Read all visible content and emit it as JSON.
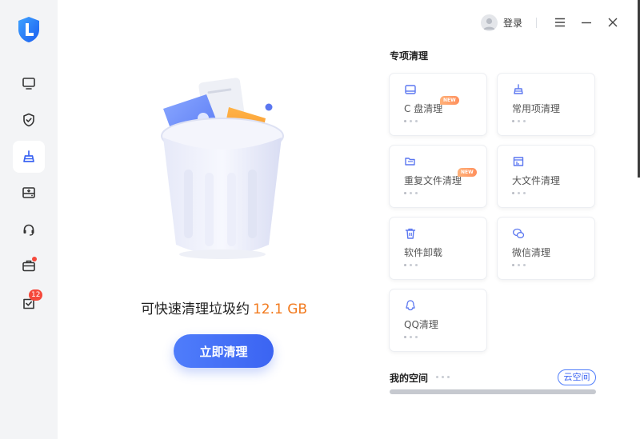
{
  "topbar": {
    "login_label": "登录",
    "avatar_icon": "user-avatar-icon",
    "menu_icon": "hamburger-menu-icon",
    "minimize_icon": "minimize-icon",
    "close_icon": "close-icon"
  },
  "sidebar": {
    "logo_icon": "shield-l-logo-icon",
    "items": [
      {
        "icon": "monitor-icon",
        "active": false
      },
      {
        "icon": "shield-check-icon",
        "active": false
      },
      {
        "icon": "broom-clean-icon",
        "active": true
      },
      {
        "icon": "hard-drive-icon",
        "active": false
      },
      {
        "icon": "headset-icon",
        "active": false
      },
      {
        "icon": "toolbox-icon",
        "active": false,
        "dot": true
      },
      {
        "icon": "mail-tasks-icon",
        "active": false,
        "badge": "12"
      }
    ]
  },
  "main": {
    "summary_prefix": "可快速清理垃圾约",
    "junk_amount": "12.1 GB",
    "clean_button": "立即清理"
  },
  "special_cleanup": {
    "title": "专项清理",
    "cards": [
      {
        "label": "C 盘清理",
        "icon": "drive-c-icon",
        "badge": "NEW"
      },
      {
        "label": "常用项清理",
        "icon": "broom-icon",
        "badge": ""
      },
      {
        "label": "重复文件清理",
        "icon": "duplicate-files-icon",
        "badge": "NEW"
      },
      {
        "label": "大文件清理",
        "icon": "large-file-icon",
        "badge": ""
      },
      {
        "label": "软件卸载",
        "icon": "trash-icon",
        "badge": ""
      },
      {
        "label": "微信清理",
        "icon": "wechat-icon",
        "badge": ""
      },
      {
        "label": "QQ清理",
        "icon": "qq-penguin-icon",
        "badge": ""
      }
    ]
  },
  "my_space": {
    "title": "我的空间",
    "cloud_button": "云空间",
    "usage_fraction": 1.0
  },
  "colors": {
    "accent": "#3b64f2",
    "amount": "#f27a1e",
    "badge": "#f5483b",
    "sidebar_bg": "#f3f4f6"
  }
}
